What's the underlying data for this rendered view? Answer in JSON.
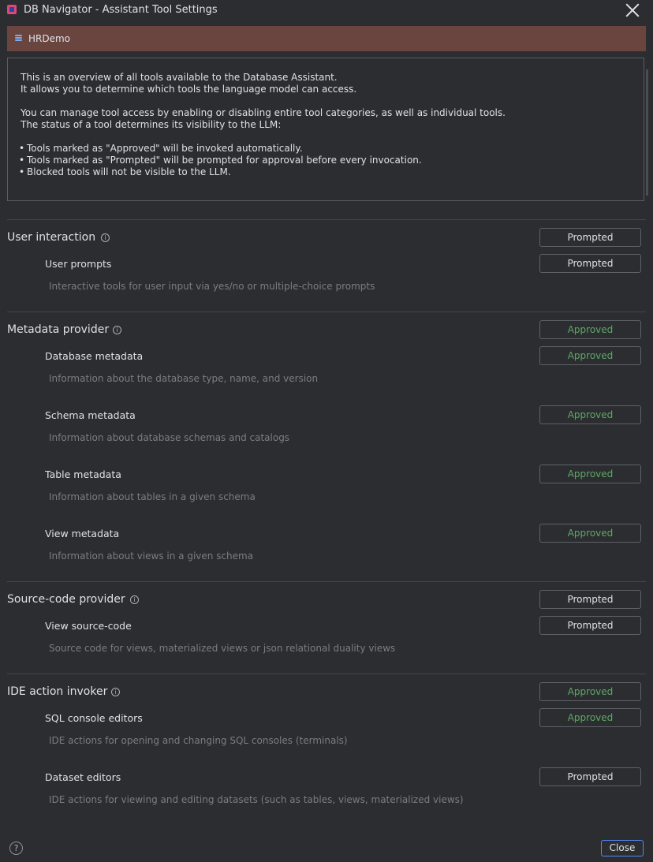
{
  "window": {
    "title": "DB Navigator - Assistant Tool Settings"
  },
  "connection": {
    "name": "HRDemo"
  },
  "overview": {
    "line1": "This is an overview of all tools available to the Database Assistant.",
    "line2": "It allows you to determine which tools the language model can access.",
    "line3": "You can manage tool access by enabling or disabling entire tool categories, as well as individual tools.",
    "line4": "The status of a tool determines its visibility to the LLM:",
    "bullets": [
      "Tools marked as \"Approved\" will be invoked automatically.",
      "Tools marked as \"Prompted\" will be prompted for approval before every invocation.",
      "Blocked tools will not be visible to the LLM."
    ]
  },
  "categories": [
    {
      "name": "User interaction",
      "status": "Prompted",
      "tools": [
        {
          "name": "User prompts",
          "status": "Prompted",
          "description": "Interactive tools for user input via yes/no or multiple-choice prompts"
        }
      ]
    },
    {
      "name": "Metadata provider",
      "status": "Approved",
      "tools": [
        {
          "name": "Database metadata",
          "status": "Approved",
          "description": "Information about the database type, name, and version"
        },
        {
          "name": "Schema metadata",
          "status": "Approved",
          "description": "Information about database schemas and catalogs"
        },
        {
          "name": "Table metadata",
          "status": "Approved",
          "description": "Information about tables in a given schema"
        },
        {
          "name": "View metadata",
          "status": "Approved",
          "description": "Information about views in a given schema"
        }
      ]
    },
    {
      "name": "Source-code provider",
      "status": "Prompted",
      "tools": [
        {
          "name": "View source-code",
          "status": "Prompted",
          "description": "Source code for views, materialized views or json relational duality views"
        }
      ]
    },
    {
      "name": "IDE action invoker",
      "status": "Approved",
      "tools": [
        {
          "name": "SQL console editors",
          "status": "Approved",
          "description": "IDE actions for opening and changing SQL consoles (terminals)"
        },
        {
          "name": "Dataset editors",
          "status": "Prompted",
          "description": "IDE actions for viewing and editing datasets (such as tables, views, materialized views)"
        }
      ]
    }
  ],
  "footer": {
    "help_label": "?",
    "close_label": "Close"
  },
  "icons": {
    "info": "info-icon",
    "database": "database-icon",
    "help": "help-icon",
    "close": "close-icon",
    "app": "app-icon"
  },
  "colors": {
    "approved": "#5fa864",
    "connection_bar": "#6a4540",
    "focus_border": "#548af7"
  }
}
